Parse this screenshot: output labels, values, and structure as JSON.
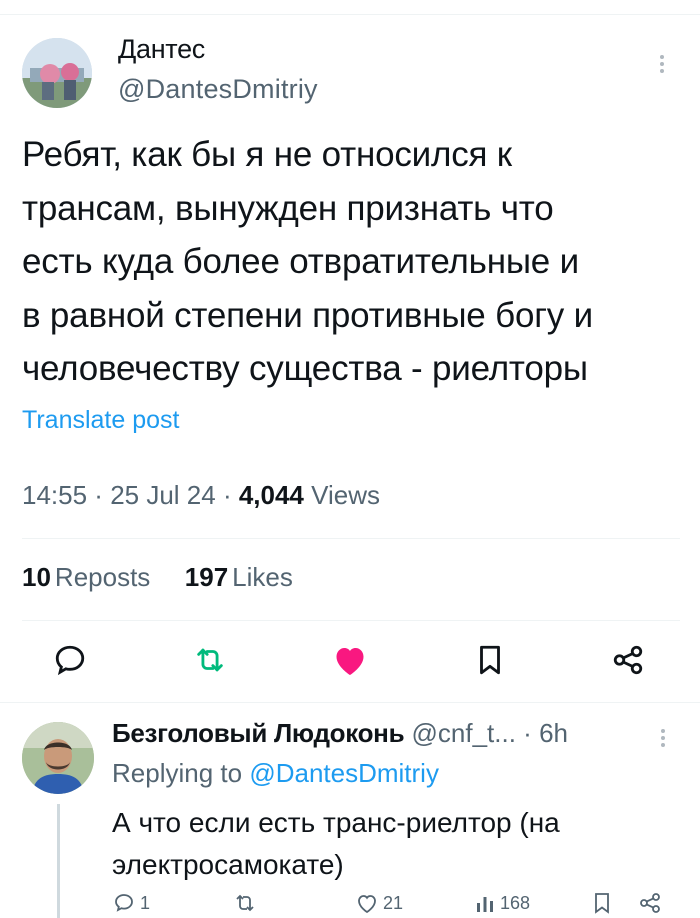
{
  "post": {
    "author": {
      "name": "Дантес",
      "handle": "@DantesDmitriy"
    },
    "text": "Ребят, как бы я не относился к\nтрансам, вынужден признать что\nесть куда более отвратительные и\nв равной степени противные богу и\nчеловечеству существа - риелторы",
    "translate_label": "Translate post",
    "time": "14:55",
    "sep": " · ",
    "date": "25 Jul 24",
    "views_count": "4,044",
    "views_label": "Views",
    "reposts_count": "10",
    "reposts_label": "Reposts",
    "likes_count": "197",
    "likes_label": "Likes",
    "actions": [
      "reply-icon",
      "repost-icon",
      "like-icon",
      "bookmark-icon",
      "share-icon"
    ],
    "colors": {
      "repost": "#00ba7c",
      "like": "#f91880",
      "accent": "#1d9bf0"
    }
  },
  "reply": {
    "author_name": "Безголовый Людоконь",
    "handle": "@cnf_t...",
    "sep": " · ",
    "age": "6h",
    "replying_prefix": "Replying to ",
    "replying_to": "@DantesDmitriy",
    "text": "А что если есть транс-риелтор (на\nэлектросамокате)",
    "counts": {
      "replies": "1",
      "likes": "21",
      "views": "168"
    }
  }
}
